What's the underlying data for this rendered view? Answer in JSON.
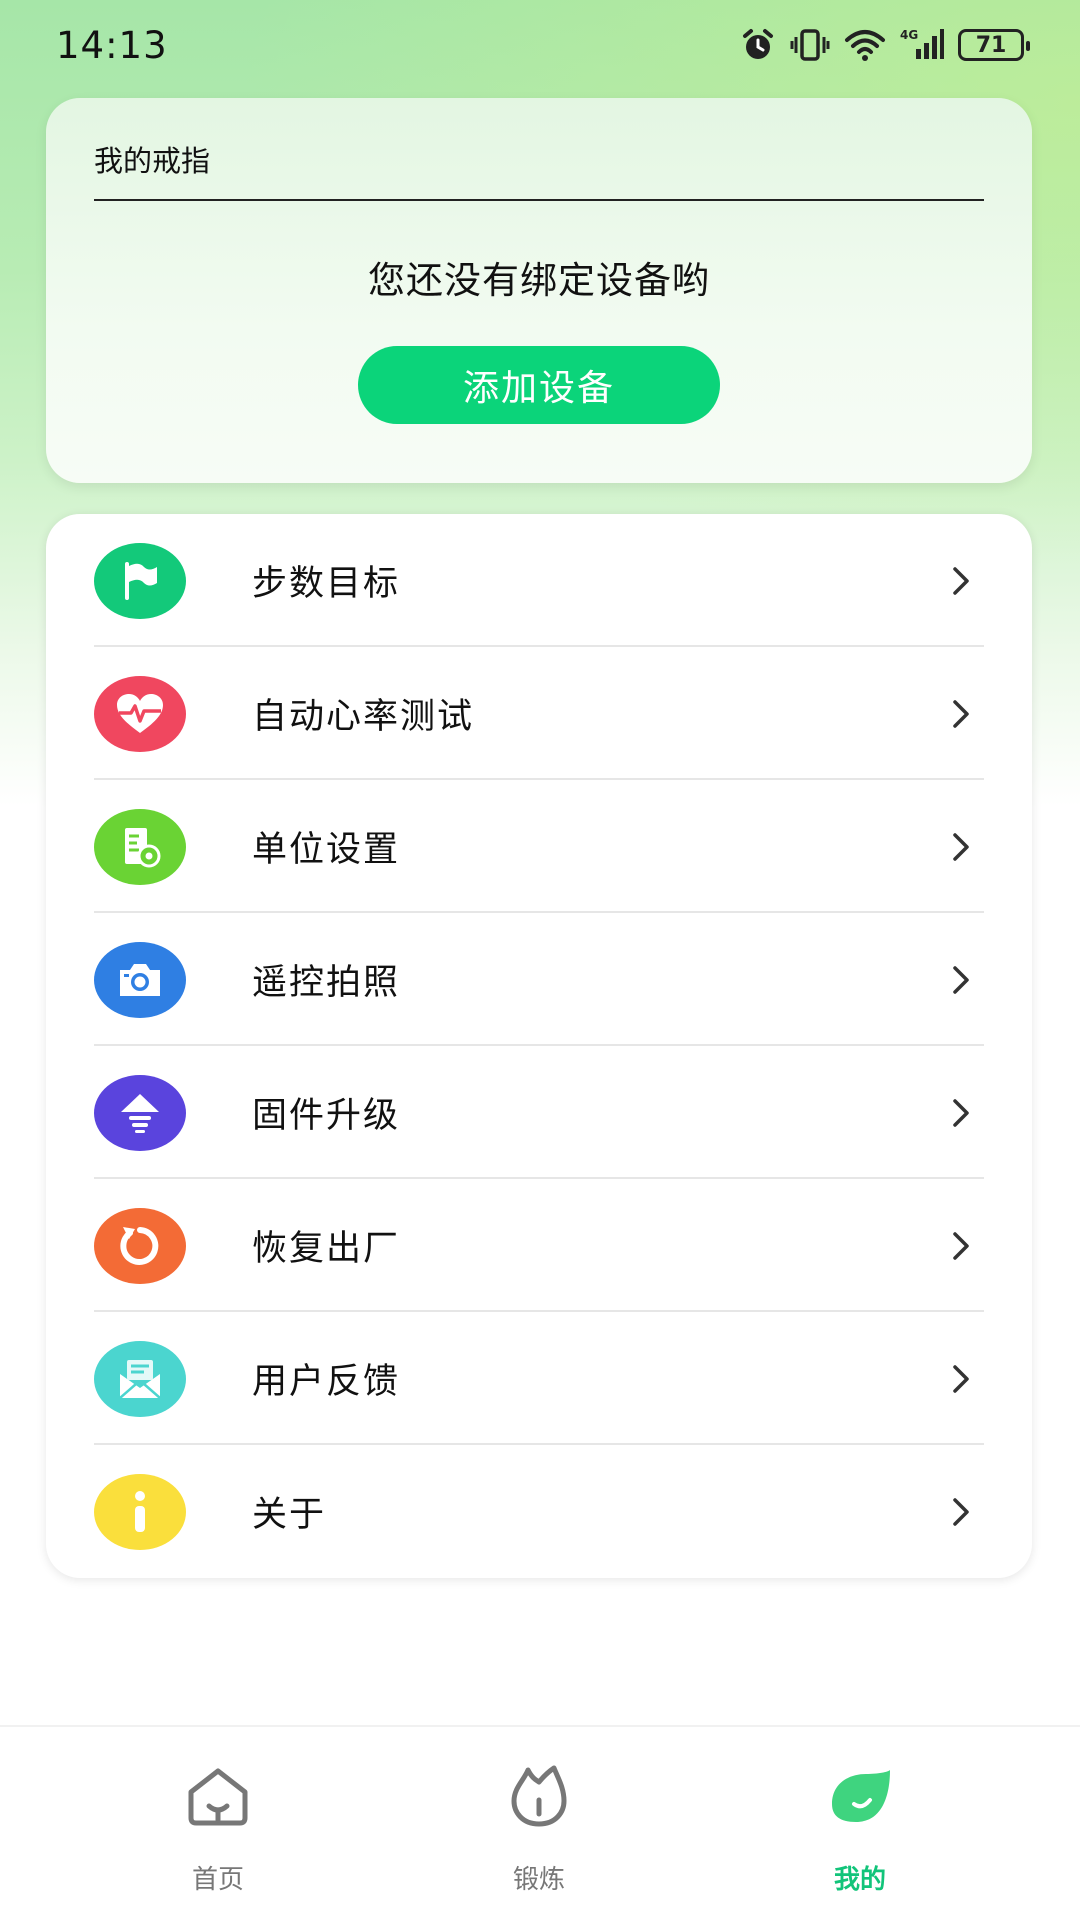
{
  "status_bar": {
    "time": "14:13",
    "battery": "71"
  },
  "ring_card": {
    "title": "我的戒指",
    "empty_message": "您还没有绑定设备哟",
    "add_button": "添加设备"
  },
  "menu": {
    "items": [
      {
        "label": "步数目标",
        "icon": "flag-icon",
        "color": "#13c97a"
      },
      {
        "label": "自动心率测试",
        "icon": "heart-rate-icon",
        "color": "#f0475f"
      },
      {
        "label": "单位设置",
        "icon": "unit-settings-icon",
        "color": "#6ad334"
      },
      {
        "label": "遥控拍照",
        "icon": "camera-icon",
        "color": "#2f7fe3"
      },
      {
        "label": "固件升级",
        "icon": "upgrade-icon",
        "color": "#5a44dd"
      },
      {
        "label": "恢复出厂",
        "icon": "reset-icon",
        "color": "#f36b36"
      },
      {
        "label": "用户反馈",
        "icon": "feedback-icon",
        "color": "#4bd5cf"
      },
      {
        "label": "关于",
        "icon": "info-icon",
        "color": "#fadf3c"
      }
    ]
  },
  "bottom_nav": {
    "items": [
      {
        "label": "首页",
        "icon": "home-icon"
      },
      {
        "label": "锻炼",
        "icon": "exercise-icon"
      },
      {
        "label": "我的",
        "icon": "profile-icon",
        "active": true
      }
    ],
    "active_color": "#12c47a"
  }
}
